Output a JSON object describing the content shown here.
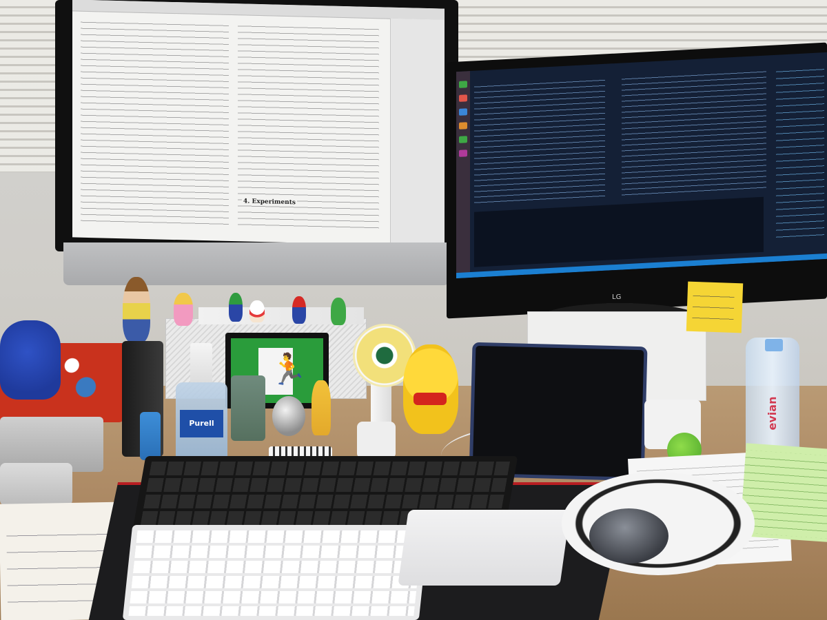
{
  "scene": {
    "apple_logo": "",
    "lg_logo": "LG",
    "exit_sign_glyph": "🏃",
    "sanitizer_brand": "Purell",
    "bottle_brand": "evian",
    "pdf_section_heading": "4. Experiments"
  },
  "colors": {
    "wall": "#d4d4d2",
    "desk": "#a98560",
    "ide_background": "#142036",
    "exit_sign_green": "#2a9c3b",
    "sticky_note": "#f5d535",
    "headphones_blue": "#2f52c5"
  }
}
